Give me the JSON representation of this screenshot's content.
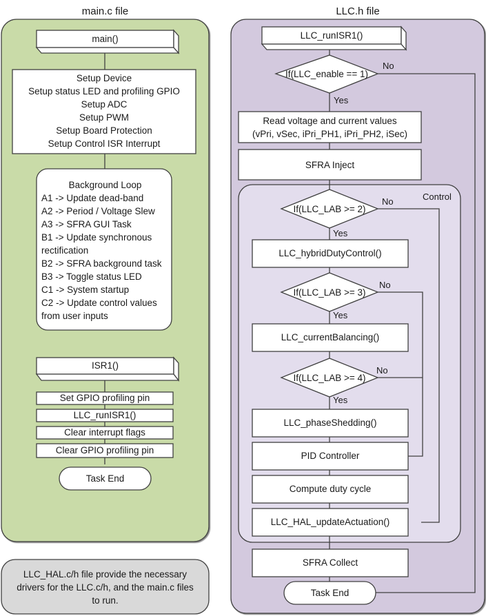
{
  "colors": {
    "main_panel_fill": "#c9dba8",
    "llc_panel_fill": "#d3c9de",
    "control_panel_fill": "#e3dded",
    "hal_note_fill": "#d9d9d9",
    "box_fill": "#ffffff",
    "line": "#404040"
  },
  "main_file": {
    "title": "main.c file",
    "entry": "main()",
    "setup_lines": [
      "Setup Device",
      "Setup status LED and profiling GPIO",
      "Setup ADC",
      "Setup PWM",
      "Setup Board Protection",
      "Setup Control ISR Interrupt"
    ],
    "background_loop": {
      "title": "Background Loop",
      "lines": [
        "A1 -> Update dead-band",
        "A2 -> Period / Voltage Slew",
        "A3 -> SFRA GUI Task",
        "B1 -> Update synchronous",
        "rectification",
        "B2 -> SFRA background task",
        "B3 -> Toggle status LED",
        "C1 -> System startup",
        "C2 -> Update control values",
        "from user inputs"
      ]
    },
    "isr_entry": "ISR1()",
    "isr_steps": [
      "Set GPIO profiling pin",
      "LLC_runISR1()",
      "Clear interrupt flags",
      "Clear GPIO profiling pin"
    ],
    "task_end": "Task End"
  },
  "hal_note": {
    "lines": [
      "LLC_HAL.c/h file provide the necessary",
      "drivers for the LLC.c/h, and the main.c files",
      "to run."
    ]
  },
  "llc_file": {
    "title": "LLC.h file",
    "entry": "LLC_runISR1()",
    "enable_check": "If(LLC_enable == 1)",
    "yes": "Yes",
    "no": "No",
    "read_values": [
      "Read voltage and current values",
      "(vPri, vSec, iPri_PH1, iPri_PH2, iSec)"
    ],
    "sfra_inject": "SFRA Inject",
    "control": {
      "label": "Control",
      "lab2_check": "If(LLC_LAB >= 2)",
      "hybrid": "LLC_hybridDutyControl()",
      "lab3_check": "If(LLC_LAB >= 3)",
      "balancing": "LLC_currentBalancing()",
      "lab4_check": "If(LLC_LAB >= 4)",
      "shedding": "LLC_phaseShedding()",
      "pid": "PID Controller",
      "duty": "Compute duty cycle",
      "actuation": "LLC_HAL_updateActuation()"
    },
    "sfra_collect": "SFRA Collect",
    "task_end": "Task End"
  }
}
